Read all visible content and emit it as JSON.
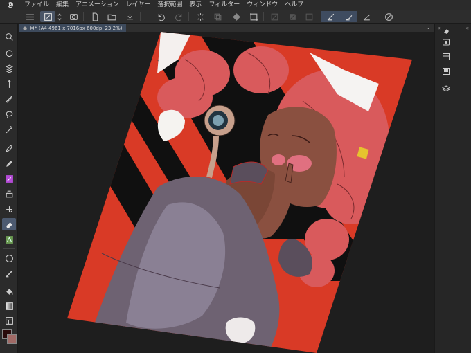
{
  "app": {
    "logo_glyph": "℗",
    "logo_icon": "clip-studio-logo"
  },
  "menu": [
    "ファイル",
    "編集",
    "アニメーション",
    "レイヤー",
    "選択範囲",
    "表示",
    "フィルター",
    "ウィンドウ",
    "ヘルプ"
  ],
  "document": {
    "tab_label": "目* (A4 4961 x 7016px 600dpi 23.2%)",
    "close_glyph": "●",
    "collapse_glyph": "⌄"
  },
  "right_panel": {
    "expand_left_glyph": "«",
    "collapse_right_glyph": "«"
  },
  "colors": {
    "main_color": "#2a0b0b",
    "sub_color": "#a06a66",
    "accent": "#4c5a70"
  },
  "toolbar_icons": [
    "menu-icon",
    "brush-select-icon",
    "stepper-icon",
    "eye-dropper-icon",
    "new-document-icon",
    "open-folder-icon",
    "save-icon",
    "undo-icon",
    "redo-icon",
    "loading-icon",
    "copy-icon",
    "fill-icon",
    "transform-icon",
    "grid-icon",
    "clear-icon",
    "crop-icon",
    "stabilization-icon",
    "snap-ruler-icon",
    "snap-special-icon",
    "edit-icon"
  ],
  "left_tool_icons": [
    "zoom-icon",
    "rotate-icon",
    "move-layer-icon",
    "object-icon",
    "selection-icon",
    "lasso-icon",
    "auto-select-icon",
    "pen-icon",
    "pencil-icon",
    "brush-icon",
    "airbrush-icon",
    "decoration-icon",
    "eraser-icon",
    "blend-icon",
    "figure-icon",
    "ruler-icon",
    "fill-tool-icon",
    "gradient-icon",
    "frame-icon"
  ]
}
